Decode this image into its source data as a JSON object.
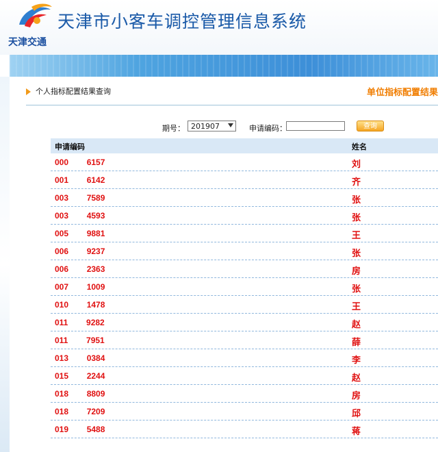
{
  "header": {
    "site_title": "天津市小客车调控管理信息系统",
    "logo_text": "天津交通"
  },
  "subheader": {
    "title": "个人指标配置结果查询",
    "unit_link": "单位指标配置结果"
  },
  "query": {
    "period_label": "期号：",
    "period_value": "201907",
    "code_label": "申请编码：",
    "code_value": "",
    "search_button": "查询"
  },
  "table": {
    "headers": {
      "code": "申请编码",
      "name": "姓名"
    },
    "rows": [
      {
        "code": "000        6157",
        "name": "刘"
      },
      {
        "code": "001        6142",
        "name": "齐"
      },
      {
        "code": "003        7589",
        "name": "张"
      },
      {
        "code": "003        4593",
        "name": "张"
      },
      {
        "code": "005        9881",
        "name": "王"
      },
      {
        "code": "006        9237",
        "name": "张"
      },
      {
        "code": "006        2363",
        "name": "房"
      },
      {
        "code": "007        1009",
        "name": "张"
      },
      {
        "code": "010        1478",
        "name": "王"
      },
      {
        "code": "011        9282",
        "name": "赵"
      },
      {
        "code": "011        7951",
        "name": "薛"
      },
      {
        "code": "013        0384",
        "name": "李"
      },
      {
        "code": "015        2244",
        "name": "赵"
      },
      {
        "code": "018        8809",
        "name": "房"
      },
      {
        "code": "018        7209",
        "name": "邱"
      },
      {
        "code": "019        5488",
        "name": "蒋"
      }
    ]
  },
  "colors": {
    "title_blue": "#1a5aa8",
    "accent_orange": "#f07d00",
    "value_red": "#e01010",
    "header_row": "#d9e8f6"
  }
}
